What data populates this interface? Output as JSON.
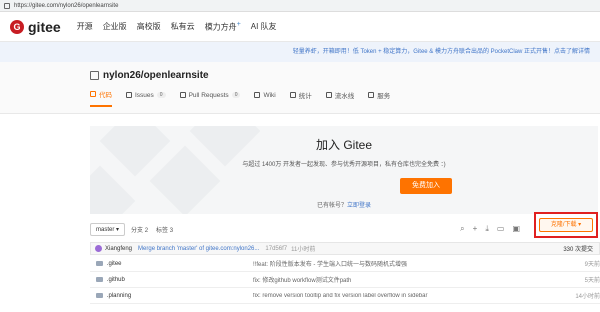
{
  "browser": {
    "url": "https://gitee.com/nylon26/openlearnsite"
  },
  "nav": {
    "logo_text": "gitee",
    "items": [
      "开源",
      "企业版",
      "高校版",
      "私有云",
      "模力方舟",
      "AI 队友"
    ],
    "plus_mark": "+"
  },
  "banner": {
    "text": "轻量养虾，开箱即用！低 Token + 稳定算力，Gitee & 模力方舟联合出品的 PocketClaw 正式开售！点击了解详情"
  },
  "repo": {
    "name": "nylon26/openlearnsite",
    "tabs": [
      {
        "label": "代码"
      },
      {
        "label": "Issues",
        "count": "0"
      },
      {
        "label": "Pull Requests",
        "count": "0"
      },
      {
        "label": "Wiki"
      },
      {
        "label": "统计"
      },
      {
        "label": "流水线"
      },
      {
        "label": "服务"
      }
    ]
  },
  "join": {
    "title": "加入 Gitee",
    "desc": "与超过 1400万 开发者一起发现、参与优秀开源项目，私有仓库也完全免费 ：)",
    "button": "免费加入",
    "login_prefix": "已有帐号？",
    "login_link": "立即登录"
  },
  "toolbar": {
    "branch": "master",
    "branches": "分支 2",
    "tags": "标签 3",
    "clone_label": "克隆/下载"
  },
  "commit": {
    "author": "Xiangfeng",
    "message": "Merge branch 'master' of gitee.com:nylon26...",
    "hash": "17d56f7",
    "time": "11小时前",
    "count": "330 次提交"
  },
  "files": [
    {
      "name": ".gitee",
      "message": "!!feat: 阶段性版本发布 - 学生端入口统一与数码随机式增强",
      "time": "9天前"
    },
    {
      "name": ".github",
      "message": "fix: 修改github workflow测试文件path",
      "time": "5天前"
    },
    {
      "name": ".planning",
      "message": "fix: remove version tooltip and fix version label overflow in sidebar",
      "time": "14小时前"
    }
  ]
}
